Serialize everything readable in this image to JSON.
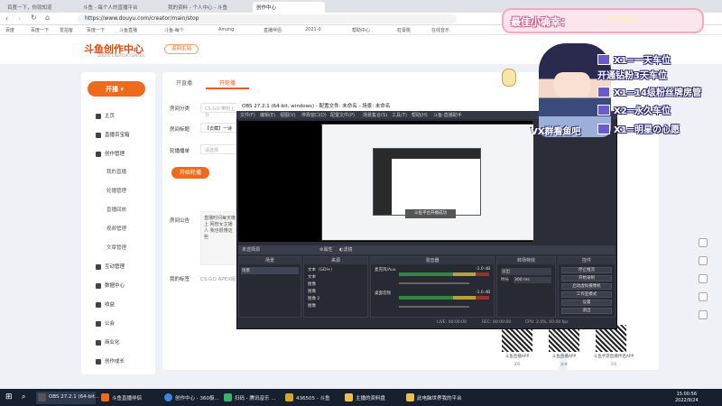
{
  "browser": {
    "tabs": [
      "百度一下，你就知道",
      "斗鱼 - 每个人的直播平台",
      "我的资料 - 个人中心 - 斗鱼",
      "创作中心"
    ],
    "url": "https://www.douyu.com/creator/main/stop",
    "bookmarks": [
      "百度",
      "百度一下",
      "爱拍客",
      "百度一下",
      "斗鱼直播",
      "斗鱼-每个",
      "Amzng",
      "直播伴侣",
      "2021-0",
      "帮助中心",
      "虹膏桃",
      "在线音乐"
    ]
  },
  "site": {
    "logo": "斗鱼创作中心",
    "logo_sub": "DOUYU CREATOR CENTER",
    "home_button": "返回主站"
  },
  "sidebar": {
    "start_button": "开播",
    "items": [
      {
        "label": "主页",
        "icon": "home-icon",
        "sub": false
      },
      {
        "label": "直播百宝箱",
        "icon": "toolbox-icon",
        "sub": false
      },
      {
        "label": "创作管理",
        "icon": "create-icon",
        "sub": false
      },
      {
        "label": "我的直播",
        "sub": true
      },
      {
        "label": "轮播管理",
        "sub": true
      },
      {
        "label": "直播回放",
        "sub": true
      },
      {
        "label": "视频管理",
        "sub": true
      },
      {
        "label": "文章管理",
        "sub": true
      },
      {
        "label": "互动管理",
        "icon": "interact-icon",
        "sub": false
      },
      {
        "label": "数据中心",
        "icon": "data-icon",
        "sub": false
      },
      {
        "label": "收益",
        "icon": "income-icon",
        "sub": false
      },
      {
        "label": "公会",
        "icon": "guild-icon",
        "sub": false
      },
      {
        "label": "商业化",
        "icon": "business-icon",
        "sub": false
      },
      {
        "label": "创作成长",
        "icon": "growth-icon",
        "sub": false
      }
    ]
  },
  "main": {
    "tabs": [
      "开直播",
      "开轮播"
    ],
    "fields": {
      "category_label": "房间分类",
      "category_value": "CS:GO-带粉上分",
      "title_label": "房间标题",
      "title_value": "【去藏】一诗",
      "playlist_label": "轮播播单",
      "playlist_placeholder": "请选择"
    },
    "start_button": "开始轮播",
    "announce_label": "房间公告",
    "announce_text": "直播时间每天晚上 网管女主播 人 我也很懂这些",
    "tag_label": "我的标签",
    "tag_value": "CS:GO APEX组"
  },
  "qr": [
    {
      "label": "斗鱼直播APP",
      "sub": "iOS"
    },
    {
      "label": "斗鱼直播APP",
      "sub": "安卓"
    },
    {
      "label": "斗鱼手游直播伴侣APP",
      "sub": "iOS"
    }
  ],
  "obs": {
    "title": "OBS 27.2.1 (64-bit, windows) - 配置文件: 未命名 - 场景: 未命名",
    "menu": [
      "文件(F)",
      "编辑(E)",
      "视图(V)",
      "停靠窗口(D)",
      "配置文件(P)",
      "场景集合(S)",
      "工具(T)",
      "帮助(H)",
      "斗鱼-直播助手"
    ],
    "no_source": "未选择源",
    "props_button": "属性",
    "filter_button": "滤镜",
    "docks": [
      "场景",
      "来源",
      "混音器",
      "转场特效",
      "控件"
    ],
    "scene": "场景",
    "sources": [
      "文本（GDI+）",
      "文本",
      "图像",
      "图像",
      "图像 2",
      "图像"
    ],
    "mixer": [
      {
        "name": "麦克风/Aux",
        "db": "-1.0 dB"
      },
      {
        "name": "桌面音频",
        "db": "-1.0 dB"
      }
    ],
    "transition": {
      "type": "淡出",
      "duration_label": "时长",
      "duration": "300 ms"
    },
    "controls": [
      "停止推流",
      "开始录制",
      "启动虚拟摄像机",
      "工作室模式",
      "设置",
      "退出"
    ],
    "status": {
      "live": "LIVE: 00:00:00",
      "rec": "REC: 00:00:00",
      "cpu": "CPU: 2.0%, 60.00 fps"
    },
    "inner_popup": "斗鱼平台开播成功"
  },
  "overlay": {
    "title": "最佳小确幸：",
    "name": "梦幻叶子",
    "lines": [
      "X1=一天车位",
      "开通钻粉3天车位",
      "X1=14级粉丝牌房管",
      "X2=永久车位",
      "X1=明星の心愿"
    ],
    "vx": "VX群看鱼吧"
  },
  "taskbar": {
    "items": [
      "OBS 27.2.1 (64-bit...",
      "斗鱼直播伴侣",
      "创作中心 - 360极...",
      "扫码 - 腾讯音乐 ...",
      "436505 - 斗鱼",
      "主播的资料盘",
      "此电脑世界我的平台"
    ],
    "time": "15:00:56",
    "date": "2022/9/24"
  }
}
